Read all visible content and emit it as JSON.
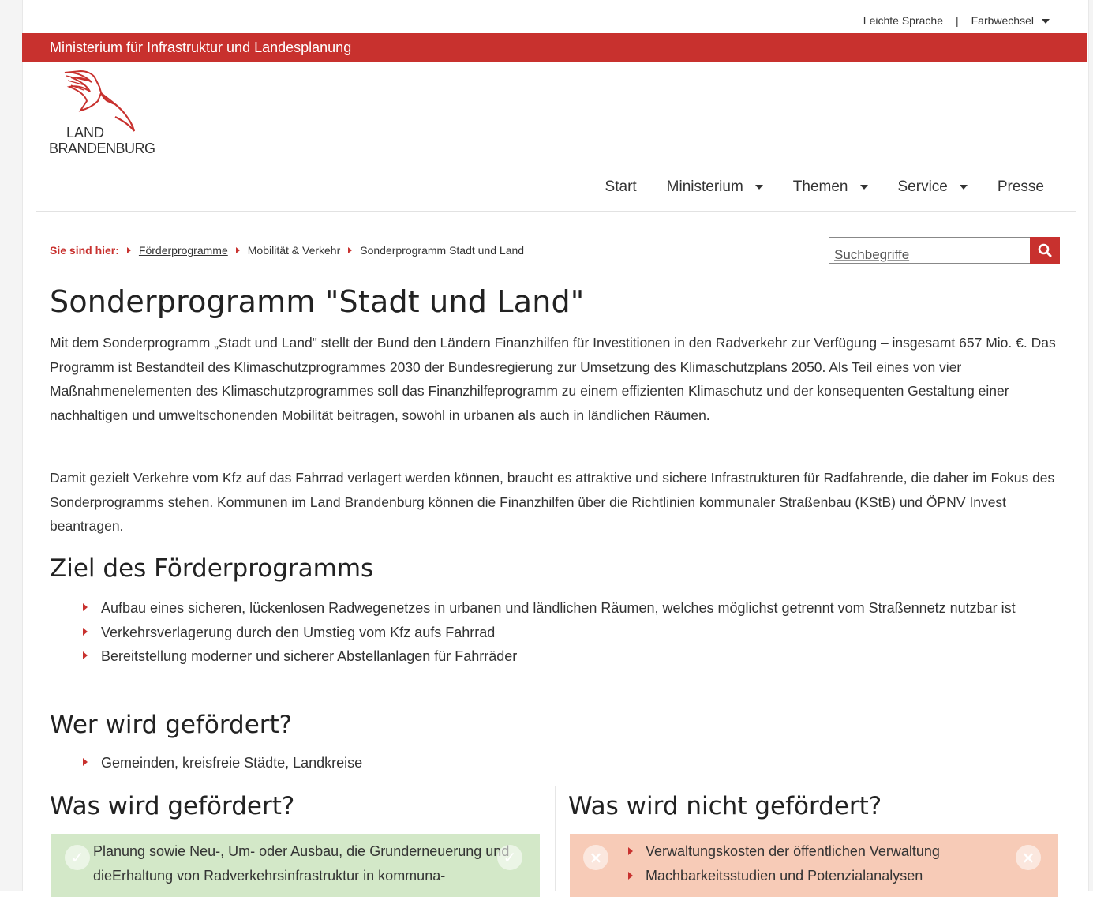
{
  "utility": {
    "easy_language": "Leichte Sprache",
    "separator": "|",
    "color_switch": "Farbwechsel"
  },
  "header": {
    "ministry": "Ministerium für Infrastruktur und Landesplanung",
    "logo_line1": "LAND",
    "logo_line2": "BRANDENBURG"
  },
  "nav": {
    "start": "Start",
    "ministerium": "Ministerium",
    "themen": "Themen",
    "service": "Service",
    "presse": "Presse"
  },
  "breadcrumb": {
    "label": "Sie sind hier:",
    "items": [
      "Förderprogramme",
      "Mobilität & Verkehr",
      "Sonderprogramm Stadt und Land"
    ]
  },
  "search": {
    "placeholder": "Suchbegriffe"
  },
  "content": {
    "title": "Sonderprogramm \"Stadt und Land\"",
    "paragraphs": [
      "Mit dem Sonderprogramm „Stadt und Land\" stellt der Bund den Ländern Finanzhilfen für Investitionen in den Radverkehr zur Verfügung – insge­samt 657 Mio. €. Das Programm ist Bestandteil des Klimaschutzprogrammes 2030 der Bundesregierung zur Umsetzung des Klimaschutzplans 2050.  Als Teil eines von vier Maßnahmenelementen des Klimaschutzprogrammes soll das Finanzhilfeprogramm zu einem effizienten Klima­schutz und der konsequenten Gestaltung einer nachhaltigen und umweltschonenden Mobilität beitragen, sowohl in urbanen als auch in ländli­chen Räumen.",
      "Damit gezielt Verkehre vom Kfz auf das Fahrrad verlagert werden können, braucht es attraktive und sichere Infrastrukturen für Radfahrende, die daher im Fokus des Sonderprogramms stehen. Kommunen im Land Brandenburg können die Finanzhilfen über die Richtlinien kommunaler Straßenbau (KStB) und ÖPNV Invest beantragen."
    ],
    "ziel_heading": "Ziel des Förderprogramms",
    "ziel_items": [
      "Aufbau eines sicheren, lückenlosen Radwegenetzes in urbanen und ländlichen Räumen, welches möglichst getrennt vom Straßennetz nutzbar ist",
      "Verkehrsverlagerung durch den Umstieg vom Kfz aufs Fahrrad",
      "Bereitstellung moderner und sicherer Abstellanlagen für Fahrräder"
    ],
    "wer_heading": "Wer wird gefördert?",
    "wer_items": [
      "Gemeinden, kreisfreie Städte, Landkreise"
    ],
    "was_heading": "Was wird gefördert?",
    "was_text": "Planung sowie Neu-, Um- oder Ausbau, die Grunderneuerung und dieErhaltung von Radverkehrsinfrastruktur in kommuna-",
    "nicht_heading": "Was wird nicht gefördert?",
    "nicht_items": [
      "Verwaltungskosten der öffentlichen Verwaltung",
      "Machbarkeitsstudien und Potenzialanalysen"
    ]
  },
  "colors": {
    "accent": "#c8312e",
    "positive_box": "#d3e8c8",
    "negative_box": "#f7cbb7"
  }
}
